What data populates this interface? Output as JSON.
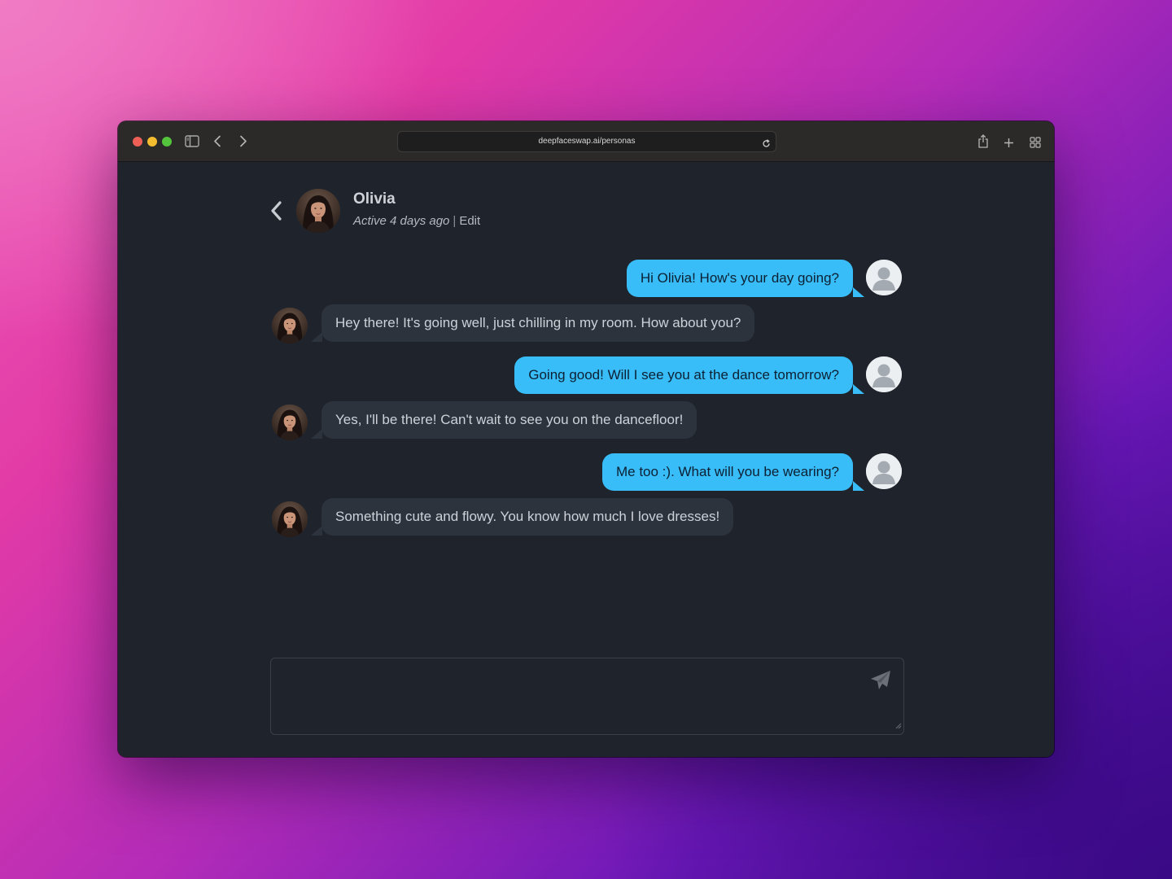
{
  "browser": {
    "url": "deepfaceswap.ai/personas"
  },
  "header": {
    "name": "Olivia",
    "active_text": "Active 4 days ago",
    "separator": "|",
    "edit_label": "Edit"
  },
  "messages": [
    {
      "sender": "user",
      "text": "Hi Olivia! How's your day going?"
    },
    {
      "sender": "persona",
      "text": "Hey there! It's going well, just chilling in my room. How about you?"
    },
    {
      "sender": "user",
      "text": "Going good! Will I see you at the dance tomorrow?"
    },
    {
      "sender": "persona",
      "text": "Yes, I'll be there! Can't wait to see you on the dancefloor!"
    },
    {
      "sender": "user",
      "text": "Me too :). What will you be wearing?"
    },
    {
      "sender": "persona",
      "text": "Something cute and flowy. You know how much I love dresses!"
    }
  ],
  "composer": {
    "value": "",
    "placeholder": ""
  },
  "colors": {
    "user_bubble": "#38bdf8",
    "persona_bubble": "#2d333d",
    "app_background": "#1f232b"
  },
  "icons": {
    "back": "chevron-left-icon",
    "send": "paper-plane-icon",
    "user_avatar": "person-silhouette-icon"
  }
}
